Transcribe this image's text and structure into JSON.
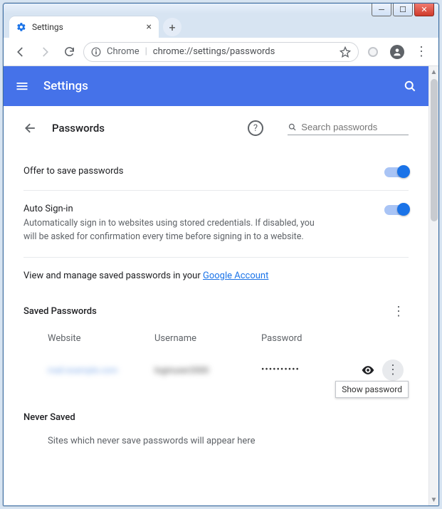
{
  "window": {
    "tab_title": "Settings",
    "omnibox_prefix": "Chrome",
    "omnibox_url": "chrome://settings/passwords"
  },
  "bluebar": {
    "title": "Settings"
  },
  "page": {
    "title": "Passwords",
    "search_placeholder": "Search passwords"
  },
  "rows": {
    "offer_label": "Offer to save passwords",
    "autosign_label": "Auto Sign-in",
    "autosign_sub": "Automatically sign in to websites using stored credentials. If disabled, you will be asked for confirmation every time before signing in to a website."
  },
  "ga": {
    "prefix": "View and manage saved passwords in your ",
    "link": "Google Account"
  },
  "saved": {
    "title": "Saved Passwords",
    "col_website": "Website",
    "col_username": "Username",
    "col_password": "Password",
    "entry_website": "mail.example.com",
    "entry_username": "loginuser2000",
    "entry_password_mask": "••••••••••",
    "tooltip": "Show password"
  },
  "never": {
    "title": "Never Saved",
    "sub": "Sites which never save passwords will appear here"
  }
}
